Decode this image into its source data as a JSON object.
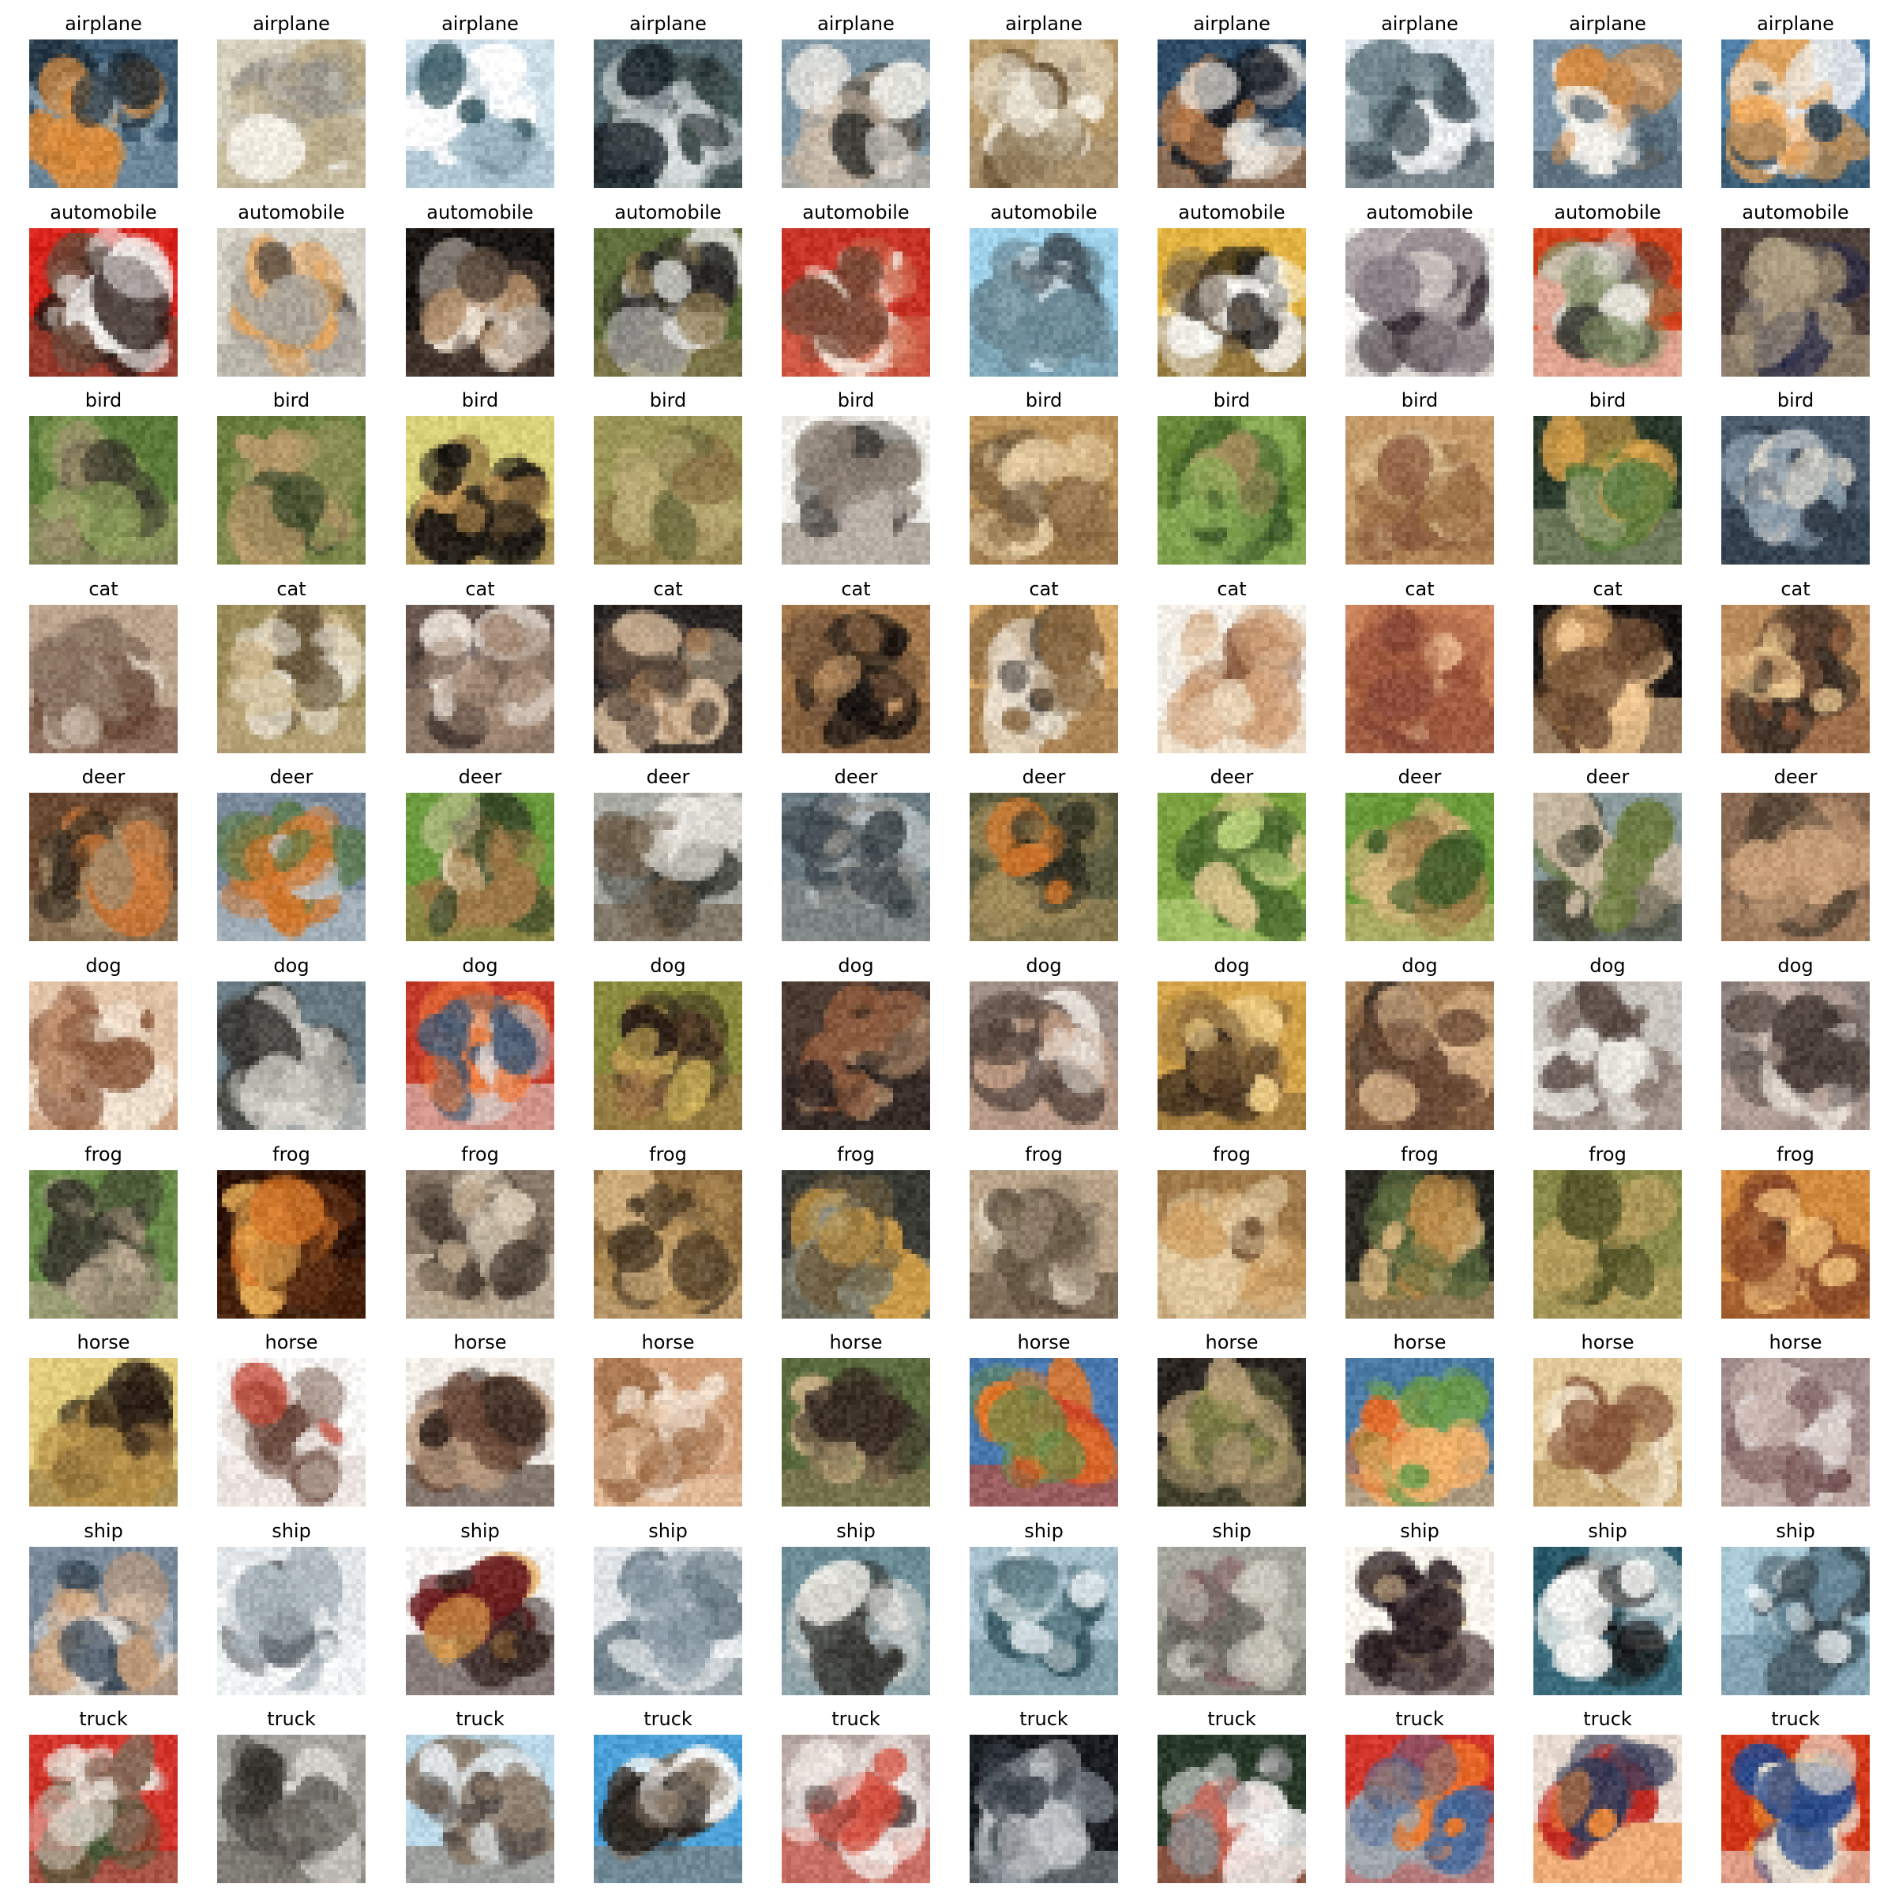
{
  "figure": {
    "rows": [
      {
        "label": "airplane",
        "palette": [
          [
            "#3d5a70",
            "#d98a3a",
            "#1e2a33",
            "#8aa2b2"
          ],
          [
            "#d6cfbd",
            "#9a958c",
            "#f0ece2",
            "#b8a987"
          ],
          [
            "#cfe0ea",
            "#2f4f58",
            "#ffffff",
            "#9fb8c4"
          ],
          [
            "#5a6f75",
            "#1a2328",
            "#d7dcdc",
            "#3c4a46"
          ],
          [
            "#7f96a4",
            "#e8e6e0",
            "#3b3a36",
            "#c7b6a3"
          ],
          [
            "#b89c6e",
            "#f4efe2",
            "#6b5538",
            "#9d8a6a"
          ],
          [
            "#2f4c66",
            "#f0ede6",
            "#1a1f26",
            "#c7824a"
          ],
          [
            "#d9e2e8",
            "#6b7e86",
            "#f5f7f8",
            "#3d4b52"
          ],
          [
            "#7f97a8",
            "#f2f0ea",
            "#d2883f",
            "#4d5f6c"
          ],
          [
            "#4f7fa6",
            "#e7e9ea",
            "#f0a85a",
            "#2f4555"
          ]
        ]
      },
      {
        "label": "automobile",
        "palette": [
          [
            "#d8231a",
            "#2c1d19",
            "#f3f2ef",
            "#6a4a3a"
          ],
          [
            "#d7d3c8",
            "#4a4541",
            "#e9a75b",
            "#a9a39a"
          ],
          [
            "#1a1614",
            "#e9ded0",
            "#b08e6c",
            "#5a4a3e"
          ],
          [
            "#5d6a3a",
            "#2b2a28",
            "#dddcd8",
            "#8d7a52"
          ],
          [
            "#c73226",
            "#f1e6da",
            "#7a4a38",
            "#d07055"
          ],
          [
            "#9fd1ea",
            "#3f4a52",
            "#e0f0f7",
            "#6a8894"
          ],
          [
            "#e2b340",
            "#1d1a18",
            "#f7f6f2",
            "#6a5a46"
          ],
          [
            "#f2f1ee",
            "#3b3238",
            "#8a7f84",
            "#d1c8c5"
          ],
          [
            "#d3441f",
            "#3b3c36",
            "#7f8c62",
            "#e6e2da"
          ],
          [
            "#4d3f3a",
            "#272a47",
            "#8a7a64",
            "#b0a085"
          ]
        ]
      },
      {
        "label": "bird",
        "palette": [
          [
            "#5b7a3a",
            "#3a3a2b",
            "#8fa05d",
            "#a09070"
          ],
          [
            "#6a7d3d",
            "#3d4a2b",
            "#b79a6b",
            "#8a8c55"
          ],
          [
            "#d9d07a",
            "#1a1714",
            "#c79a5a",
            "#8a6a3e"
          ],
          [
            "#9a9456",
            "#6d6a3e",
            "#b8a974",
            "#8c7447"
          ],
          [
            "#f0eee9",
            "#3a3633",
            "#b8b0a6",
            "#8a7e72"
          ],
          [
            "#b8925a",
            "#5a4a38",
            "#e2c9a0",
            "#8a6a44"
          ],
          [
            "#6a8a3a",
            "#3d5a2b",
            "#a08a5a",
            "#8fb05a"
          ],
          [
            "#c49a6a",
            "#8a5a3e",
            "#e2c79a",
            "#a0764a"
          ],
          [
            "#2b3a2b",
            "#5a7a3d",
            "#d6a04a",
            "#9aa07a"
          ],
          [
            "#4a5a6a",
            "#8a9aa8",
            "#d6d1c5",
            "#2a3440"
          ]
        ]
      },
      {
        "label": "cat",
        "palette": [
          [
            "#b9a38d",
            "#8a7462",
            "#e3d6c7",
            "#6a4a3a"
          ],
          [
            "#9a8a5a",
            "#f0ebe0",
            "#6a5a3e",
            "#c9b48a"
          ],
          [
            "#6a5a52",
            "#e8ded4",
            "#3a2e2a",
            "#a48a76"
          ],
          [
            "#2a2624",
            "#a07a56",
            "#d9bfa0",
            "#5a4a3e"
          ],
          [
            "#a0764a",
            "#1a1512",
            "#d1a270",
            "#7a5a3e"
          ],
          [
            "#d6a86a",
            "#2a2420",
            "#f0e6d6",
            "#8a6a44"
          ],
          [
            "#f2eee6",
            "#d1a27a",
            "#8a5a3e",
            "#e9d4b8"
          ],
          [
            "#c9825a",
            "#a05a3e",
            "#e6b48a",
            "#8a4a3a"
          ],
          [
            "#1a1614",
            "#d6a46a",
            "#6a4a32",
            "#f0c894"
          ],
          [
            "#b98a5a",
            "#3a2e26",
            "#e2c08a",
            "#8a5a3e"
          ]
        ]
      },
      {
        "label": "deer",
        "palette": [
          [
            "#6a4a32",
            "#c9783a",
            "#3a2e22",
            "#a08a6a"
          ],
          [
            "#7a8a9a",
            "#d1782e",
            "#5a7a4a",
            "#b9c4cc"
          ],
          [
            "#6a9a3d",
            "#d9c9a6",
            "#3a4a2a",
            "#a07a4a"
          ],
          [
            "#a9aaa4",
            "#3a3a34",
            "#e2e0d8",
            "#6a5a46"
          ],
          [
            "#6a7a80",
            "#3a4248",
            "#b9c0c2",
            "#8a8a86"
          ],
          [
            "#5a5a3e",
            "#d1782e",
            "#2a2a20",
            "#a08a5a"
          ],
          [
            "#7aa040",
            "#d6c08a",
            "#4a6a2e",
            "#b8d07a"
          ],
          [
            "#6a9a3a",
            "#a07a4a",
            "#3a5a2a",
            "#d1b47a"
          ],
          [
            "#8a9a9a",
            "#6a7a3e",
            "#c9b8a0",
            "#4a4a3a"
          ],
          [
            "#8a6a52",
            "#c9a07a",
            "#5a4a3a",
            "#b08a6a"
          ]
        ]
      },
      {
        "label": "dog",
        "palette": [
          [
            "#e0c2a6",
            "#8a5a3e",
            "#f0e2d2",
            "#c09070"
          ],
          [
            "#6a7a82",
            "#a4a29c",
            "#3a3834",
            "#d9d6ce"
          ],
          [
            "#c23a2a",
            "#4a5a70",
            "#f07a3a",
            "#d9d0cc"
          ],
          [
            "#8a8a3e",
            "#2a1e18",
            "#d1b45a",
            "#a0764a"
          ],
          [
            "#4a3a32",
            "#8a5a3e",
            "#c9a07a",
            "#2a2220"
          ],
          [
            "#9a8a82",
            "#f2ede6",
            "#5a4a42",
            "#c9a48a"
          ],
          [
            "#d1a24a",
            "#3a2a1e",
            "#f0d08a",
            "#8a6a3e"
          ],
          [
            "#a07a52",
            "#3a2e26",
            "#d9b48a",
            "#6a4a36"
          ],
          [
            "#c9c4bd",
            "#5a4a44",
            "#ebe8e2",
            "#8a7a72"
          ],
          [
            "#8a7e7a",
            "#e0d6ce",
            "#4a3e3a",
            "#b8a49a"
          ]
        ]
      },
      {
        "label": "frog",
        "palette": [
          [
            "#6a8a4a",
            "#8a7a6a",
            "#3a3a2e",
            "#b8a890"
          ],
          [
            "#2a1208",
            "#d8782a",
            "#f0b45a",
            "#5a2e14"
          ],
          [
            "#8a7a6a",
            "#b9a48a",
            "#4a3e34",
            "#d6c8b4"
          ],
          [
            "#8a6a3e",
            "#b8925a",
            "#4a3a26",
            "#d1b080"
          ],
          [
            "#3a3a34",
            "#d1a04a",
            "#6a5a3e",
            "#8a8a7a"
          ],
          [
            "#b9a48a",
            "#8a7a66",
            "#d9ccb8",
            "#5a4a3a"
          ],
          [
            "#a07a4a",
            "#d1a46a",
            "#6a4a2e",
            "#e0c8a0"
          ],
          [
            "#2a2a22",
            "#b88a4a",
            "#5a6a3e",
            "#d1b07a"
          ],
          [
            "#8a8a4a",
            "#d1c07a",
            "#5a5a2e",
            "#b8a060"
          ],
          [
            "#d18a3e",
            "#3a2218",
            "#f0c07a",
            "#8a4a2a"
          ]
        ]
      },
      {
        "label": "horse",
        "palette": [
          [
            "#e0cc7a",
            "#2a1e16",
            "#b8924a",
            "#8a6a3e"
          ],
          [
            "#f7f6f4",
            "#c04a3a",
            "#6a4a3e",
            "#e2d8d2"
          ],
          [
            "#f0ebe4",
            "#6a4a3a",
            "#b89a80",
            "#3a2a22"
          ],
          [
            "#d1a07a",
            "#f0e0d0",
            "#a0704a",
            "#e6c4a4"
          ],
          [
            "#5a6a3e",
            "#3a2e26",
            "#d1b48a",
            "#8a7a5a"
          ],
          [
            "#4a7ab0",
            "#e0782a",
            "#6a8a4a",
            "#d14a2a"
          ],
          [
            "#2a2420",
            "#8a8a4a",
            "#b9a07a",
            "#5a5a3a"
          ],
          [
            "#4a7aa4",
            "#e06a2a",
            "#6a9a4a",
            "#f0b06a"
          ],
          [
            "#e0c89a",
            "#8a5a3e",
            "#f0e2c8",
            "#b8925a"
          ],
          [
            "#a08a8a",
            "#e0d6d2",
            "#6a4a4a",
            "#c9b4ae"
          ]
        ]
      },
      {
        "label": "ship",
        "palette": [
          [
            "#7a8a9a",
            "#f0ece6",
            "#3a4a5a",
            "#c9a07a"
          ],
          [
            "#e2e6e8",
            "#3a3e42",
            "#a9b4ba",
            "#f7f8f8"
          ],
          [
            "#f7f6f4",
            "#6a1e22",
            "#e0a04a",
            "#3a2a26"
          ],
          [
            "#dfe3e6",
            "#8a9aa6",
            "#f2f4f5",
            "#6a7a84"
          ],
          [
            "#6a8a94",
            "#e6e4de",
            "#3a3a36",
            "#a4b0b2"
          ],
          [
            "#a8c0cc",
            "#3a5a64",
            "#e8eef0",
            "#6a8a94"
          ],
          [
            "#a4a49a",
            "#8a6a6a",
            "#c9c6bc",
            "#6a6a62"
          ],
          [
            "#f7f3ea",
            "#2a1e22",
            "#e0c49a",
            "#6a5a5a"
          ],
          [
            "#2a5a6a",
            "#f2f2f0",
            "#1a1a1a",
            "#4a7a8a"
          ],
          [
            "#a8c8d6",
            "#3a4a52",
            "#f2f6f8",
            "#6a8a9a"
          ]
        ]
      },
      {
        "label": "truck",
        "palette": [
          [
            "#d1342a",
            "#4a5a3a",
            "#e8e0d8",
            "#8a6a5a"
          ],
          [
            "#a4a29c",
            "#3a3632",
            "#e2e0dc",
            "#6a6660"
          ],
          [
            "#b9d6e6",
            "#4a4240",
            "#e8f0f4",
            "#8a7a6a"
          ],
          [
            "#4aa0d6",
            "#2a2420",
            "#f7f6f4",
            "#8a7a6a"
          ],
          [
            "#b8a8a4",
            "#f2ece8",
            "#5a4a4a",
            "#d14a3a"
          ],
          [
            "#1a1e22",
            "#c9ccce",
            "#3a4048",
            "#8a9096"
          ],
          [
            "#2a3a2a",
            "#f2f2f0",
            "#8a8a8a",
            "#d16a5a"
          ],
          [
            "#d1342a",
            "#f07a2a",
            "#4a6a9a",
            "#a0a8b0"
          ],
          [
            "#e8dcd2",
            "#c42a22",
            "#3a3e5a",
            "#f08a3a"
          ],
          [
            "#d1381a",
            "#f0a03a",
            "#2a4a8a",
            "#e8e0d0"
          ]
        ]
      }
    ]
  }
}
